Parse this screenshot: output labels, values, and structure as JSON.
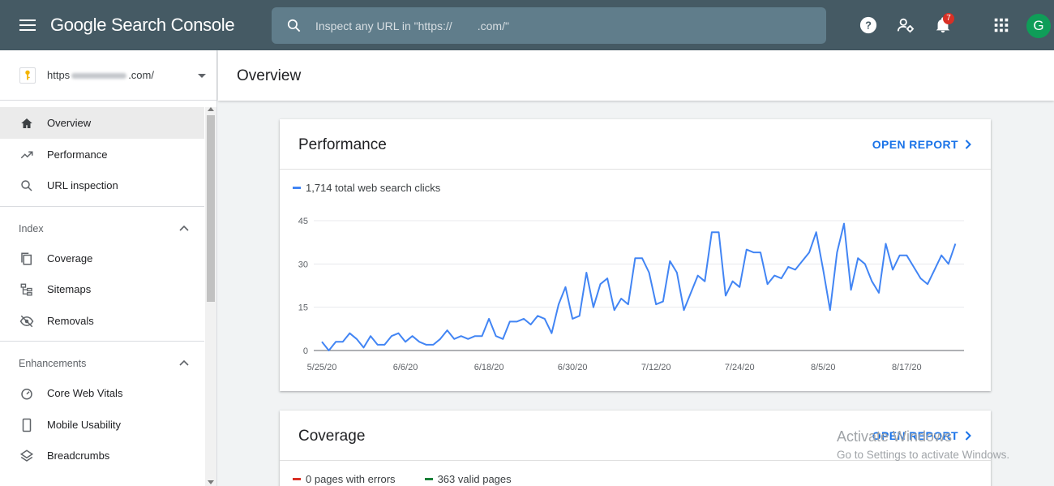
{
  "header": {
    "app_title": "Google Search Console",
    "search_placeholder": "Inspect any URL in \"https://        .com/\"",
    "notification_count": "7",
    "avatar_letter": "G",
    "colors": {
      "bar": "#455a64",
      "search": "#607d8b",
      "badge": "#d93025",
      "avatar": "#0f9d58"
    }
  },
  "sidebar": {
    "property": {
      "prefix": "https",
      "suffix": ".com/"
    },
    "items": [
      {
        "label": "Overview",
        "icon": "home-icon",
        "active": true
      },
      {
        "label": "Performance",
        "icon": "trending-up-icon"
      },
      {
        "label": "URL inspection",
        "icon": "search-icon"
      }
    ],
    "index": {
      "label": "Index",
      "items": [
        {
          "label": "Coverage",
          "icon": "coverage-icon"
        },
        {
          "label": "Sitemaps",
          "icon": "sitemap-icon"
        },
        {
          "label": "Removals",
          "icon": "removals-icon"
        }
      ]
    },
    "enhancements": {
      "label": "Enhancements",
      "items": [
        {
          "label": "Core Web Vitals",
          "icon": "gauge-icon"
        },
        {
          "label": "Mobile Usability",
          "icon": "phone-icon"
        },
        {
          "label": "Breadcrumbs",
          "icon": "layers-icon"
        }
      ]
    }
  },
  "main": {
    "page_title": "Overview",
    "performance": {
      "title": "Performance",
      "open_report": "OPEN REPORT",
      "legend": "1,714 total web search clicks",
      "legend_color": "#4285f4"
    },
    "coverage": {
      "title": "Coverage",
      "open_report": "OPEN REPORT",
      "errors_label": "0 pages with errors",
      "valid_label": "363 valid pages",
      "errors_color": "#d93025",
      "valid_color": "#188038"
    }
  },
  "watermark": {
    "line1": "Activate Windows",
    "line2": "Go to Settings to activate Windows."
  },
  "chart_data": {
    "type": "line",
    "x": [
      "5/25/20",
      "5/26/20",
      "5/27/20",
      "5/28/20",
      "5/29/20",
      "5/30/20",
      "5/31/20",
      "6/1/20",
      "6/2/20",
      "6/3/20",
      "6/4/20",
      "6/5/20",
      "6/6/20",
      "6/7/20",
      "6/8/20",
      "6/9/20",
      "6/10/20",
      "6/11/20",
      "6/12/20",
      "6/13/20",
      "6/14/20",
      "6/15/20",
      "6/16/20",
      "6/17/20",
      "6/18/20",
      "6/19/20",
      "6/20/20",
      "6/21/20",
      "6/22/20",
      "6/23/20",
      "6/24/20",
      "6/25/20",
      "6/26/20",
      "6/27/20",
      "6/28/20",
      "6/29/20",
      "6/30/20",
      "7/1/20",
      "7/2/20",
      "7/3/20",
      "7/4/20",
      "7/5/20",
      "7/6/20",
      "7/7/20",
      "7/8/20",
      "7/9/20",
      "7/10/20",
      "7/11/20",
      "7/12/20",
      "7/13/20",
      "7/14/20",
      "7/15/20",
      "7/16/20",
      "7/17/20",
      "7/18/20",
      "7/19/20",
      "7/20/20",
      "7/21/20",
      "7/22/20",
      "7/23/20",
      "7/24/20",
      "7/25/20",
      "7/26/20",
      "7/27/20",
      "7/28/20",
      "7/29/20",
      "7/30/20",
      "7/31/20",
      "8/1/20",
      "8/2/20",
      "8/3/20",
      "8/4/20",
      "8/5/20",
      "8/6/20",
      "8/7/20",
      "8/8/20",
      "8/9/20",
      "8/10/20",
      "8/11/20",
      "8/12/20",
      "8/13/20",
      "8/14/20",
      "8/15/20",
      "8/16/20",
      "8/17/20",
      "8/18/20",
      "8/19/20",
      "8/20/20",
      "8/21/20",
      "8/22/20",
      "8/23/20",
      "8/24/20",
      "8/25/20"
    ],
    "series": [
      {
        "color": "#4285f4",
        "values": [
          3,
          0,
          3,
          3,
          6,
          4,
          1,
          5,
          2,
          2,
          5,
          6,
          3,
          5,
          3,
          2,
          2,
          4,
          7,
          4,
          5,
          4,
          5,
          5,
          11,
          5,
          4,
          10,
          10,
          11,
          9,
          12,
          11,
          6,
          16,
          22,
          11,
          12,
          27,
          15,
          23,
          25,
          14,
          18,
          16,
          32,
          32,
          27,
          16,
          17,
          31,
          27,
          14,
          20,
          26,
          24,
          41,
          41,
          19,
          24,
          22,
          35,
          34,
          34,
          23,
          26,
          25,
          29,
          28,
          31,
          34,
          41,
          28,
          14,
          34,
          44,
          21,
          32,
          30,
          24,
          20,
          37,
          28,
          33,
          33,
          29,
          25,
          23,
          28,
          33,
          30,
          37
        ]
      }
    ],
    "xticks": [
      "5/25/20",
      "6/6/20",
      "6/18/20",
      "6/30/20",
      "7/12/20",
      "7/24/20",
      "8/5/20",
      "8/17/20"
    ],
    "yticks": [
      0,
      15,
      30,
      45
    ],
    "ylim": [
      0,
      45
    ],
    "xlabel": "",
    "ylabel": "",
    "grid": true
  }
}
